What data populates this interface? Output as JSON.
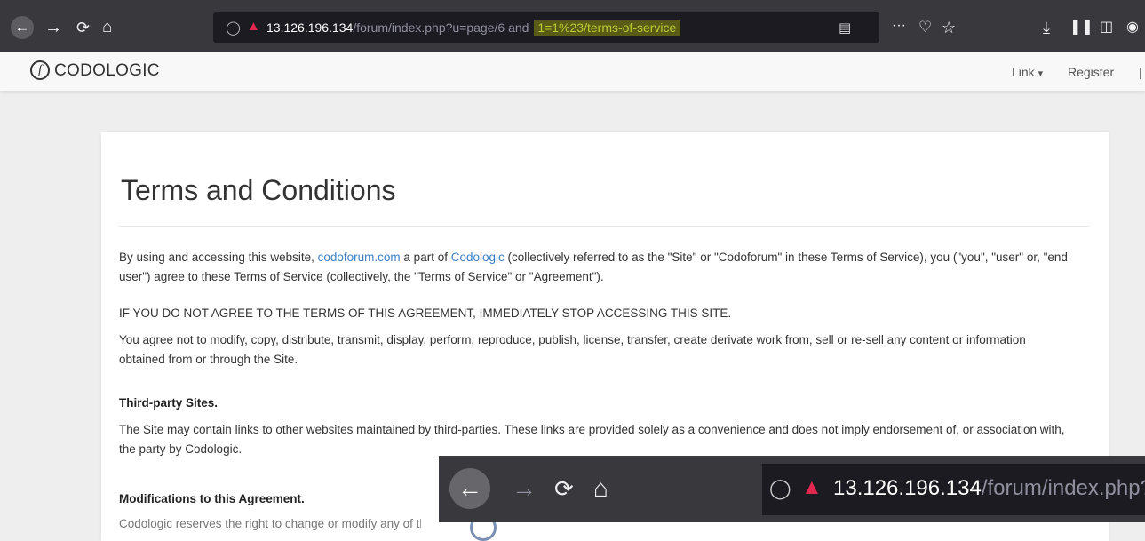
{
  "browser": {
    "url_host": "13.126.196.134",
    "url_path": "/forum/index.php?u=page/6 and",
    "url_injection": "1=1%23/terms-of-service",
    "icons": [
      "back-icon",
      "forward-icon",
      "reload-icon",
      "home-icon",
      "shield-icon",
      "insecure-lock-icon",
      "reader-view-icon",
      "more-icon",
      "pocket-icon",
      "bookmark-star-icon",
      "download-icon",
      "library-icon",
      "sidebar-icon",
      "account-icon"
    ],
    "more_label": "···"
  },
  "site": {
    "logo_mark": "f",
    "logo_text": "CODOLOGIC",
    "nav": {
      "link_label": "Link",
      "link_caret": "▾",
      "register_label": "Register"
    }
  },
  "page": {
    "title": "Terms and Conditions",
    "intro": {
      "before_link1": "By using and accessing this website, ",
      "link1": "codoforum.com",
      "between_links": " a part of ",
      "link2": "Codologic",
      "after_link2": " (collectively referred to as the \"Site\" or \"Codoforum\" in these Terms of Service), you (\"you\", \"user\" or, \"end user\") agree to these Terms of Service (collectively, the \"Terms of Service\" or \"Agreement\")."
    },
    "warning": "IF YOU DO NOT AGREE TO THE TERMS OF THIS AGREEMENT, IMMEDIATELY STOP ACCESSING THIS SITE.",
    "usage": "You agree not to modify, copy, distribute, transmit, display, perform, reproduce, publish, license, transfer, create derivate work from, sell or re-sell any content or information obtained from or through the Site.",
    "third_party_heading": "Third-party Sites.",
    "third_party_text": "The Site may contain links to other websites maintained by third-parties. These links are provided solely as a convenience and does not imply endorsement of, or association with, the party by Codologic.",
    "modifications_heading": "Modifications to this Agreement.",
    "modifications_text_partial": "Codologic reserves the right to change or modify any of the"
  },
  "zoom_overlay": {
    "url_host": "13.126.196.134",
    "url_path": "/forum/index.php?u="
  },
  "colors": {
    "toolbar": "#38383d",
    "url_highlight": "#b8cc3a",
    "link": "#3b7ec3",
    "insecure_lock": "#e22850"
  }
}
